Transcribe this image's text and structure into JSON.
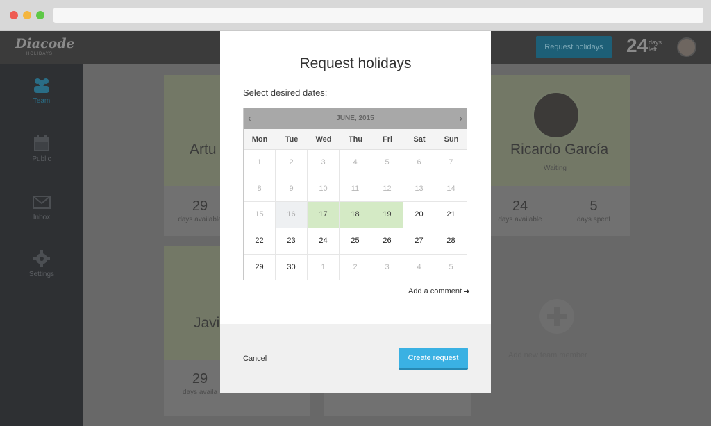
{
  "browser": {
    "url": ""
  },
  "app": {
    "logo": "Diacode",
    "logo_sub": "HOLIDAYS",
    "request_button": "Request holidays",
    "days_left_number": "24",
    "days_left_label_1": "days",
    "days_left_label_2": "left"
  },
  "sidebar": {
    "items": [
      {
        "label": "Team",
        "icon": "team-icon"
      },
      {
        "label": "Public",
        "icon": "calendar-icon"
      },
      {
        "label": "Inbox",
        "icon": "mail-icon"
      },
      {
        "label": "Settings",
        "icon": "gear-icon"
      }
    ]
  },
  "team": {
    "cards": [
      {
        "name": "Artu",
        "available": "29",
        "available_label": "days available"
      },
      {
        "name": "Ricardo García",
        "status": "Waiting",
        "available": "24",
        "available_label": "days available",
        "spent": "5",
        "spent_label": "days spent"
      },
      {
        "name": "Javi",
        "available": "29",
        "available_label": "days availa"
      }
    ],
    "add_member_label": "Add new team member"
  },
  "modal": {
    "title": "Request holidays",
    "subtitle": "Select desired dates:",
    "calendar": {
      "month": "JUNE, 2015",
      "prev": "‹",
      "next": "›",
      "weekdays": [
        "Mon",
        "Tue",
        "Wed",
        "Thu",
        "Fri",
        "Sat",
        "Sun"
      ],
      "weeks": [
        [
          "1",
          "2",
          "3",
          "4",
          "5",
          "6",
          "7"
        ],
        [
          "8",
          "9",
          "10",
          "11",
          "12",
          "13",
          "14"
        ],
        [
          "15",
          "16",
          "17",
          "18",
          "19",
          "20",
          "21"
        ],
        [
          "22",
          "23",
          "24",
          "25",
          "26",
          "27",
          "28"
        ],
        [
          "29",
          "30",
          "1",
          "2",
          "3",
          "4",
          "5"
        ]
      ],
      "selected": [
        "17",
        "18",
        "19"
      ]
    },
    "add_comment": "Add a comment",
    "cancel": "Cancel",
    "create": "Create request"
  }
}
